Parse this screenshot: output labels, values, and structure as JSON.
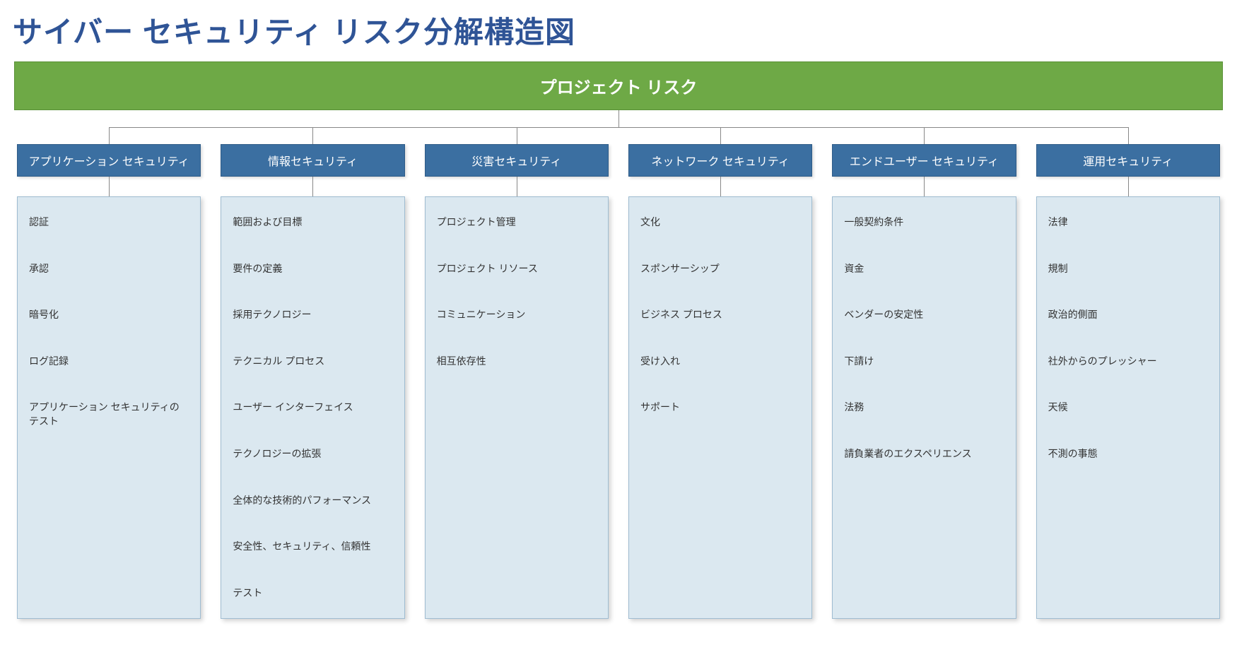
{
  "title": "サイバー セキュリティ リスク分解構造図",
  "root": "プロジェクト リスク",
  "columns": [
    {
      "header": "アプリケーション セキュリティ",
      "items": [
        "認証",
        "承認",
        "暗号化",
        "ログ記録",
        "アプリケーション セキュリティのテスト"
      ]
    },
    {
      "header": "情報セキュリティ",
      "items": [
        "範囲および目標",
        "要件の定義",
        "採用テクノロジー",
        "テクニカル プロセス",
        "ユーザー インターフェイス",
        "テクノロジーの拡張",
        "全体的な技術的パフォーマンス",
        "安全性、セキュリティ、信頼性",
        "テスト"
      ]
    },
    {
      "header": "災害セキュリティ",
      "items": [
        "プロジェクト管理",
        "プロジェクト リソース",
        "コミュニケーション",
        "相互依存性"
      ]
    },
    {
      "header": "ネットワーク セキュリティ",
      "items": [
        "文化",
        "スポンサーシップ",
        "ビジネス プロセス",
        "受け入れ",
        "サポート"
      ]
    },
    {
      "header": "エンドユーザー セキュリティ",
      "items": [
        "一般契約条件",
        "資金",
        "ベンダーの安定性",
        "下請け",
        "法務",
        "請負業者のエクスペリエンス"
      ]
    },
    {
      "header": "運用セキュリティ",
      "items": [
        "法律",
        "規制",
        "政治的側面",
        "社外からのプレッシャー",
        "天候",
        "不測の事態"
      ]
    }
  ],
  "colors": {
    "title": "#2f5496",
    "root_bg": "#6ea946",
    "col_header_bg": "#3b6fa1",
    "col_body_bg": "#dbe8f0"
  }
}
